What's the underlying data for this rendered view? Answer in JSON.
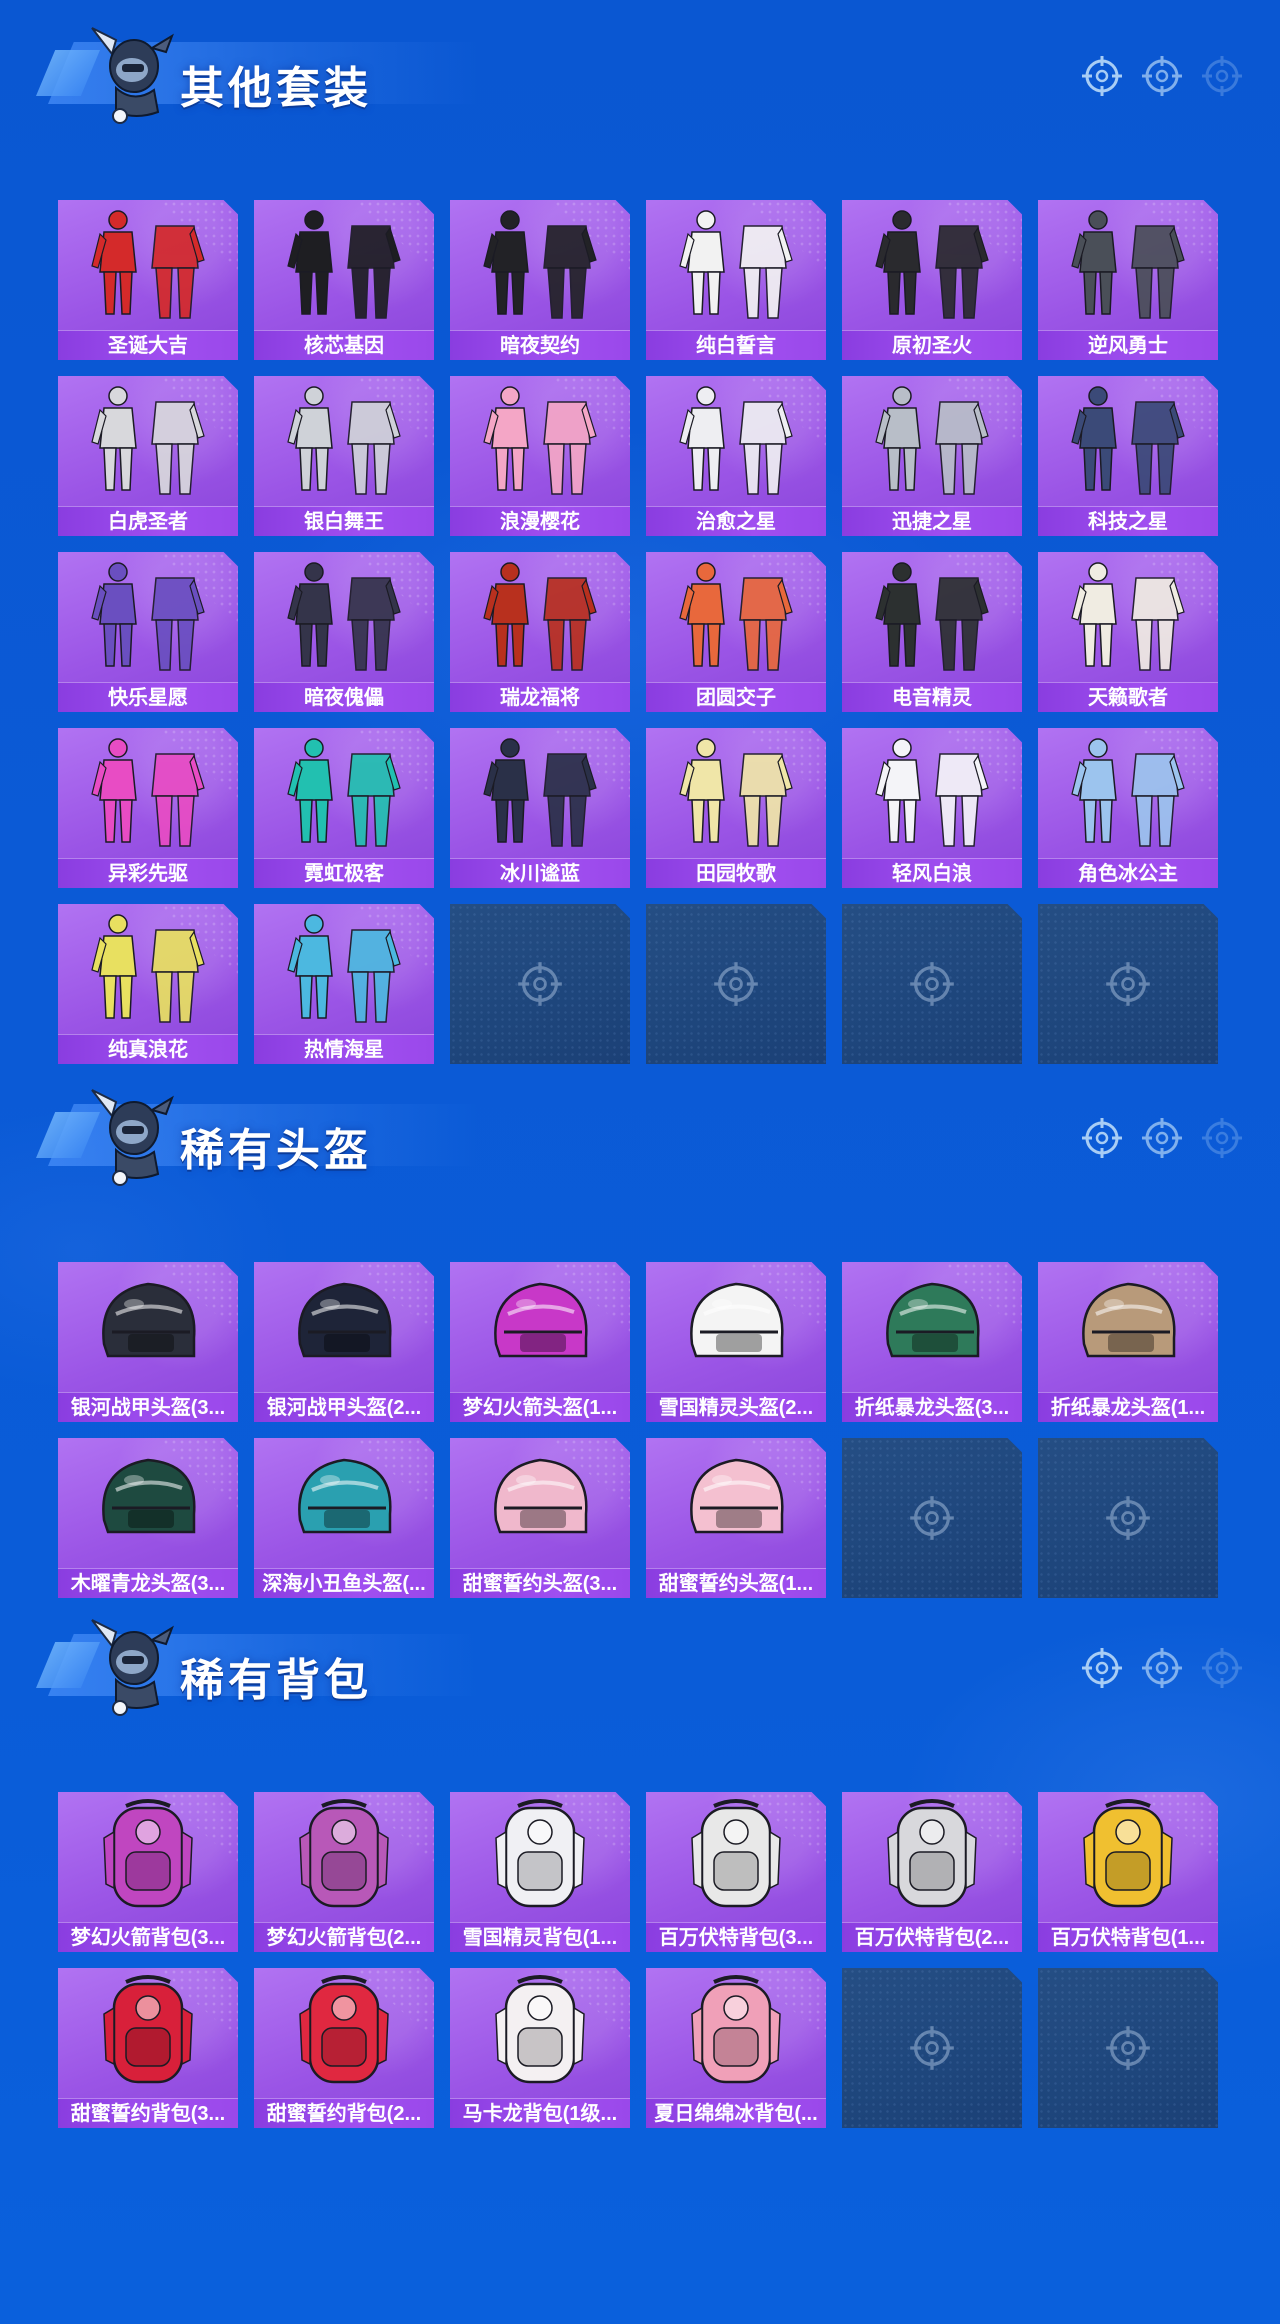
{
  "sections": [
    {
      "id": "suits",
      "title": "其他套装",
      "items": [
        {
          "label": "圣诞大吉",
          "kind": "suit",
          "color": "#d42a2a"
        },
        {
          "label": "核芯基因",
          "kind": "suit",
          "color": "#1e1e22"
        },
        {
          "label": "暗夜契约",
          "kind": "suit",
          "color": "#222226"
        },
        {
          "label": "纯白誓言",
          "kind": "suit",
          "color": "#f2f2f2"
        },
        {
          "label": "原初圣火",
          "kind": "suit",
          "color": "#2a2a2e"
        },
        {
          "label": "逆风勇士",
          "kind": "suit",
          "color": "#4a4f58"
        },
        {
          "label": "白虎圣者",
          "kind": "suit",
          "color": "#d8d8dc"
        },
        {
          "label": "银白舞王",
          "kind": "suit",
          "color": "#cfd2d8"
        },
        {
          "label": "浪漫樱花",
          "kind": "suit",
          "color": "#f4a6c6"
        },
        {
          "label": "治愈之星",
          "kind": "suit",
          "color": "#eeeef2"
        },
        {
          "label": "迅捷之星",
          "kind": "suit",
          "color": "#b8bec8"
        },
        {
          "label": "科技之星",
          "kind": "suit",
          "color": "#3b4a78"
        },
        {
          "label": "快乐星愿",
          "kind": "suit",
          "color": "#6a4fc0"
        },
        {
          "label": "暗夜傀儡",
          "kind": "suit",
          "color": "#34344a"
        },
        {
          "label": "瑞龙福将",
          "kind": "suit",
          "color": "#b8301e"
        },
        {
          "label": "团圆交子",
          "kind": "suit",
          "color": "#e8683c"
        },
        {
          "label": "电音精灵",
          "kind": "suit",
          "color": "#2c3030"
        },
        {
          "label": "天籁歌者",
          "kind": "suit",
          "color": "#f0ece2"
        },
        {
          "label": "异彩先驱",
          "kind": "suit",
          "color": "#e84cc4"
        },
        {
          "label": "霓虹极客",
          "kind": "suit",
          "color": "#22c0b0"
        },
        {
          "label": "冰川谧蓝",
          "kind": "suit",
          "color": "#2a3048"
        },
        {
          "label": "田园牧歌",
          "kind": "suit",
          "color": "#f0e6a8"
        },
        {
          "label": "轻风白浪",
          "kind": "suit",
          "color": "#f4f4f8"
        },
        {
          "label": "角色冰公主",
          "kind": "suit",
          "color": "#9cc4ee"
        },
        {
          "label": "纯真浪花",
          "kind": "suit",
          "color": "#e8e060"
        },
        {
          "label": "热情海星",
          "kind": "suit",
          "color": "#4cb8e0"
        }
      ],
      "empty_slots": 4
    },
    {
      "id": "helmets",
      "title": "稀有头盔",
      "items": [
        {
          "label": "银河战甲头盔(3...",
          "kind": "helmet",
          "color": "#2a2e3a"
        },
        {
          "label": "银河战甲头盔(2...",
          "kind": "helmet",
          "color": "#1e2438"
        },
        {
          "label": "梦幻火箭头盔(1...",
          "kind": "helmet",
          "color": "#c838c8"
        },
        {
          "label": "雪国精灵头盔(2...",
          "kind": "helmet",
          "color": "#f4f4f4"
        },
        {
          "label": "折纸暴龙头盔(3...",
          "kind": "helmet",
          "color": "#2e7a5a"
        },
        {
          "label": "折纸暴龙头盔(1...",
          "kind": "helmet",
          "color": "#b89a7a"
        },
        {
          "label": "木曜青龙头盔(3...",
          "kind": "helmet",
          "color": "#1e4a40"
        },
        {
          "label": "深海小丑鱼头盔(...",
          "kind": "helmet",
          "color": "#2aa0b0"
        },
        {
          "label": "甜蜜誓约头盔(3...",
          "kind": "helmet",
          "color": "#f0b8cc"
        },
        {
          "label": "甜蜜誓约头盔(1...",
          "kind": "helmet",
          "color": "#f4c0d0"
        }
      ],
      "empty_slots": 2
    },
    {
      "id": "backpacks",
      "title": "稀有背包",
      "items": [
        {
          "label": "梦幻火箭背包(3...",
          "kind": "bag",
          "color": "#c046c0"
        },
        {
          "label": "梦幻火箭背包(2...",
          "kind": "bag",
          "color": "#b858b8"
        },
        {
          "label": "雪国精灵背包(1...",
          "kind": "bag",
          "color": "#f0f0f4"
        },
        {
          "label": "百万伏特背包(3...",
          "kind": "bag",
          "color": "#e8e8e8"
        },
        {
          "label": "百万伏特背包(2...",
          "kind": "bag",
          "color": "#d8d8dc"
        },
        {
          "label": "百万伏特背包(1...",
          "kind": "bag",
          "color": "#f0c030"
        },
        {
          "label": "甜蜜誓约背包(3...",
          "kind": "bag",
          "color": "#d8203a"
        },
        {
          "label": "甜蜜誓约背包(2...",
          "kind": "bag",
          "color": "#e02840"
        },
        {
          "label": "马卡龙背包(1级...",
          "kind": "bag",
          "color": "#f4f0f2"
        },
        {
          "label": "夏日绵绵冰背包(...",
          "kind": "bag",
          "color": "#f0a0b8"
        }
      ],
      "empty_slots": 2
    }
  ],
  "icons": {
    "mascot": "mascot-icon",
    "header_crosshair": "crosshair-icon",
    "empty_slot": "crosshair-icon"
  },
  "colors": {
    "background": "#0a57d2",
    "card_fill": "#9b55e6",
    "label_bar": "#9a48ea",
    "empty_slot": "#1e467c"
  }
}
